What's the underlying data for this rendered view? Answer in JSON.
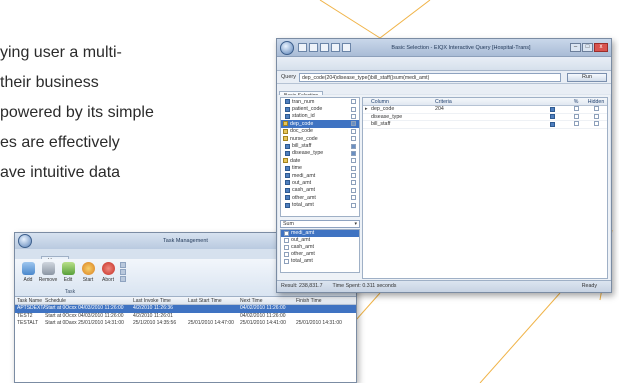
{
  "promo_lines": [
    "ying user a multi-",
    "their business",
    "powered by its simple",
    "es are effectively",
    "ave intuitive data"
  ],
  "main_window": {
    "title": "Basic Selection - EIQX Interactive Query [Hospital-Trans]",
    "caption_buttons": [
      "–",
      "□",
      "x"
    ],
    "query_label": "Query",
    "query_value": "dep_code(204)disease_type()bill_staff()sum(medi_amt)",
    "run_label": "Run",
    "tab_label": "Basic Selection",
    "fields": [
      {
        "label": "tran_num",
        "group": false,
        "checked": false,
        "selected": false
      },
      {
        "label": "patient_code",
        "group": false,
        "checked": false,
        "selected": false
      },
      {
        "label": "station_id",
        "group": false,
        "checked": false,
        "selected": false
      },
      {
        "label": "dep_code",
        "group": true,
        "checked": true,
        "selected": true
      },
      {
        "label": "doc_code",
        "group": true,
        "checked": false,
        "selected": false
      },
      {
        "label": "nurse_code",
        "group": true,
        "checked": false,
        "selected": false
      },
      {
        "label": "bill_staff",
        "group": false,
        "checked": true,
        "selected": false
      },
      {
        "label": "disease_type",
        "group": false,
        "checked": true,
        "selected": false
      },
      {
        "label": "date",
        "group": true,
        "checked": false,
        "selected": false
      },
      {
        "label": "time",
        "group": false,
        "checked": false,
        "selected": false
      },
      {
        "label": "medi_amt",
        "group": false,
        "checked": false,
        "selected": false
      },
      {
        "label": "out_amt",
        "group": false,
        "checked": false,
        "selected": false
      },
      {
        "label": "cash_amt",
        "group": false,
        "checked": false,
        "selected": false
      },
      {
        "label": "other_amt",
        "group": false,
        "checked": false,
        "selected": false
      },
      {
        "label": "total_amt",
        "group": false,
        "checked": false,
        "selected": false
      }
    ],
    "aggregate_select": "Sum",
    "aggregate_fields": [
      {
        "label": "medi_amt",
        "selected": true
      },
      {
        "label": "out_amt",
        "selected": false
      },
      {
        "label": "cash_amt",
        "selected": false
      },
      {
        "label": "other_amt",
        "selected": false
      },
      {
        "label": "total_amt",
        "selected": false
      }
    ],
    "criteria_headers": {
      "column": "Column",
      "criteria": "Criteria",
      "pct": "%",
      "hidden": "Hidden"
    },
    "criteria_rows": [
      {
        "column": "dep_code",
        "criteria": "204",
        "current": true
      },
      {
        "column": "disease_type",
        "criteria": "",
        "current": false
      },
      {
        "column": "bill_staff",
        "criteria": "",
        "current": false
      }
    ],
    "status": {
      "result": "Result: 238,831.7",
      "time_spent": "Time Spent: 0.311 seconds",
      "ready": "Ready"
    }
  },
  "task_window": {
    "title": "Task Management",
    "ribbon_tab": "Home",
    "buttons": [
      {
        "label": "Add",
        "icon": "add-icon"
      },
      {
        "label": "Remove",
        "icon": "remove-icon"
      },
      {
        "label": "Edit",
        "icon": "edit-icon"
      },
      {
        "label": "Start",
        "icon": "start-icon"
      },
      {
        "label": "Abort",
        "icon": "abort-icon"
      }
    ],
    "group_label": "Task",
    "columns": {
      "name": "Task Name ▲",
      "schedule": "Schedule",
      "last": "Last Invoke Time",
      "last_start": "Last Start Time",
      "next": "Next Time",
      "finish": "Finish Time"
    },
    "rows": [
      {
        "name": "APTSDEXTASK",
        "schedule": "Start at 0Ocxx 04/03/2010 11:26:00",
        "last": "4/2/2010 11:26:36",
        "last_start": "",
        "next": "04/02/2010 11:26:00",
        "finish": "",
        "selected": true
      },
      {
        "name": "TEST2",
        "schedule": "Start at 0Ocxx 04/03/2010 11:26:00",
        "last": "4/2/2010 11:26:01",
        "last_start": "",
        "next": "04/02/2010 11:26:00",
        "finish": "",
        "selected": false
      },
      {
        "name": "TESTALT",
        "schedule": "Start at 0Daxx 25/01/2010 14:31:00",
        "last": "25/1/2010 14:35:56",
        "last_start": "25/01/2010 14:47:00",
        "next": "25/01/2010 14:41:00",
        "finish": "25/01/2010 14:31:00",
        "selected": false
      }
    ]
  },
  "colors": {
    "accent_line": "#f0b347",
    "selection": "#3f73c2"
  }
}
